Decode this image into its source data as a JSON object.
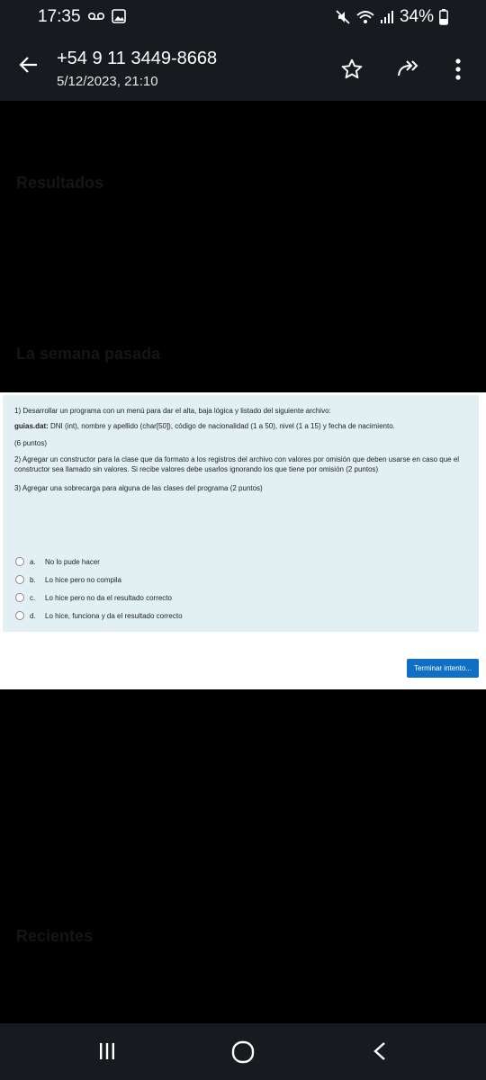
{
  "status_bar": {
    "time": "17:35",
    "battery": "34%",
    "icons": [
      "voicemail-icon",
      "image-icon",
      "mute-icon",
      "wifi-icon",
      "signal-icon",
      "battery-icon"
    ]
  },
  "app_bar": {
    "title": "+54 9 11 3449-8668",
    "subtitle": "5/12/2023, 21:10",
    "icons": [
      "back-arrow-icon",
      "star-icon",
      "share-icon",
      "more-vert-icon"
    ]
  },
  "background_text": {
    "t1": "Resultados",
    "t2": "La semana pasada",
    "t3": "Recientes"
  },
  "quiz": {
    "q1_line": "1) Desarrollar un programa con un menú para dar el alta, baja lógica y listado del siguiente archivo:",
    "q1_file": "guias.dat:",
    "q1_file_desc": " DNI (int), nombre y apellido (char[50]), código de nacionalidad (1 a 50), nivel (1 a 15) y fecha de nacimiento.",
    "q1_points": "(6 puntos)",
    "q2": "2) Agregar un constructor para la clase que da formato a los registros del archivo con valores por omisión que deben usarse en caso que el constructor sea llamado sin valores. Si recibe valores debe usarlos ignorando los que tiene por omisión (2 puntos)",
    "q3": "3) Agregar una sobrecarga para alguna de las clases del programa (2 puntos)",
    "options": [
      {
        "letter": "a.",
        "text": "No lo pude hacer"
      },
      {
        "letter": "b.",
        "text": "Lo hice pero no compila"
      },
      {
        "letter": "c.",
        "text": "Lo hice pero no da el resultado correcto"
      },
      {
        "letter": "d.",
        "text": "Lo hice, funciona y da el resultado correcto"
      }
    ],
    "finish_button": "Terminar intento..."
  },
  "nav_bar": {
    "icons": [
      "recents-icon",
      "home-icon",
      "back-icon"
    ]
  }
}
